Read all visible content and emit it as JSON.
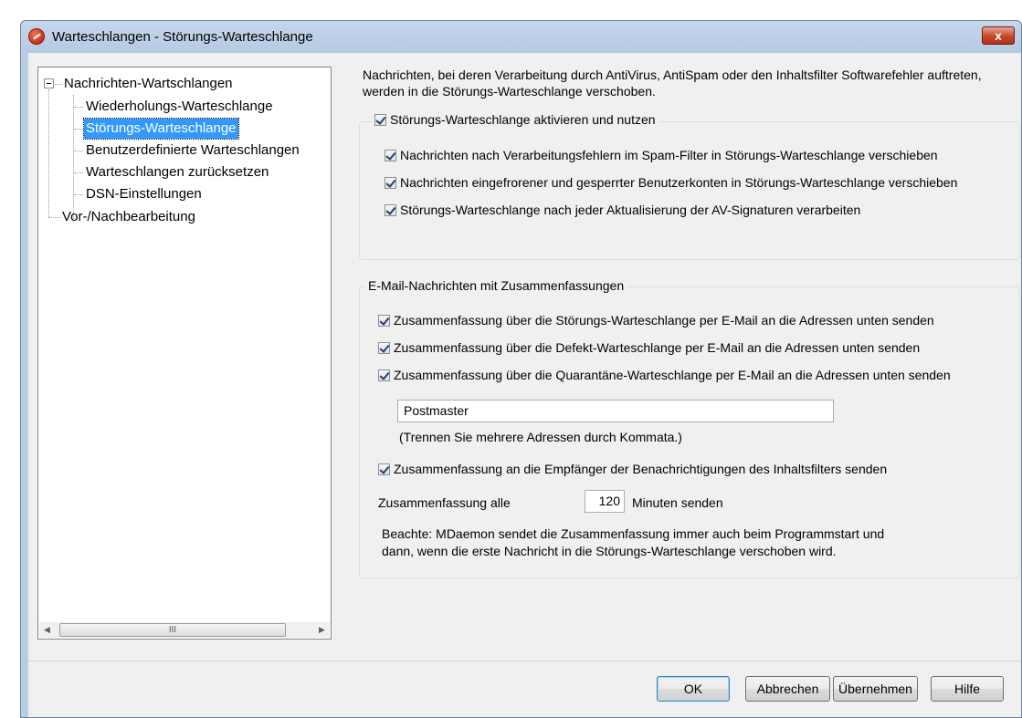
{
  "window": {
    "title": "Warteschlangen - Störungs-Warteschlange",
    "close_label": "x"
  },
  "tree": {
    "items": [
      {
        "label": "Nachrichten-Wartschlangen"
      },
      {
        "label": "Wiederholungs-Warteschlange"
      },
      {
        "label": "Störungs-Warteschlange"
      },
      {
        "label": "Benutzerdefinierte Warteschlangen"
      },
      {
        "label": "Warteschlangen zurücksetzen"
      },
      {
        "label": "DSN-Einstellungen"
      },
      {
        "label": "Vor-/Nachbearbeitung"
      }
    ],
    "scroll_thumb": "III",
    "scroll_left": "◀",
    "scroll_right": "▶"
  },
  "intro": "Nachrichten, bei deren Verarbeitung durch AntiVirus, AntiSpam oder den Inhaltsfilter Softwarefehler auftreten, werden in die Störungs-Warteschlange verschoben.",
  "group1": {
    "legend": "Störungs-Warteschlange aktivieren und nutzen",
    "options": [
      "Nachrichten nach Verarbeitungsfehlern im Spam-Filter in Störungs-Warteschlange verschieben",
      "Nachrichten eingefrorener und gesperrter Benutzerkonten in Störungs-Warteschlange verschieben",
      "Störungs-Warteschlange nach jeder Aktualisierung der AV-Signaturen verarbeiten"
    ]
  },
  "group2": {
    "legend": "E-Mail-Nachrichten mit Zusammenfassungen",
    "options": [
      "Zusammenfassung über die Störungs-Warteschlange per E-Mail an die Adressen unten senden",
      "Zusammenfassung über die Defekt-Warteschlange per E-Mail an die Adressen unten senden",
      "Zusammenfassung über die Quarantäne-Warteschlange per E-Mail an die Adressen unten senden"
    ],
    "addresses_value": "Postmaster",
    "addresses_hint": "(Trennen Sie mehrere Adressen durch Kommata.)",
    "recipients_option": "Zusammenfassung an die Empfänger der Benachrichtigungen des Inhaltsfilters senden",
    "interval_prefix": "Zusammenfassung alle",
    "interval_value": "120",
    "interval_suffix": "Minuten senden",
    "note_line1": "Beachte: MDaemon sendet die Zusammenfassung immer auch beim Programmstart und",
    "note_line2": "dann, wenn die erste Nachricht in die Störungs-Warteschlange verschoben wird."
  },
  "buttons": {
    "ok": "OK",
    "cancel": "Abbrechen",
    "apply": "Übernehmen",
    "help": "Hilfe"
  }
}
